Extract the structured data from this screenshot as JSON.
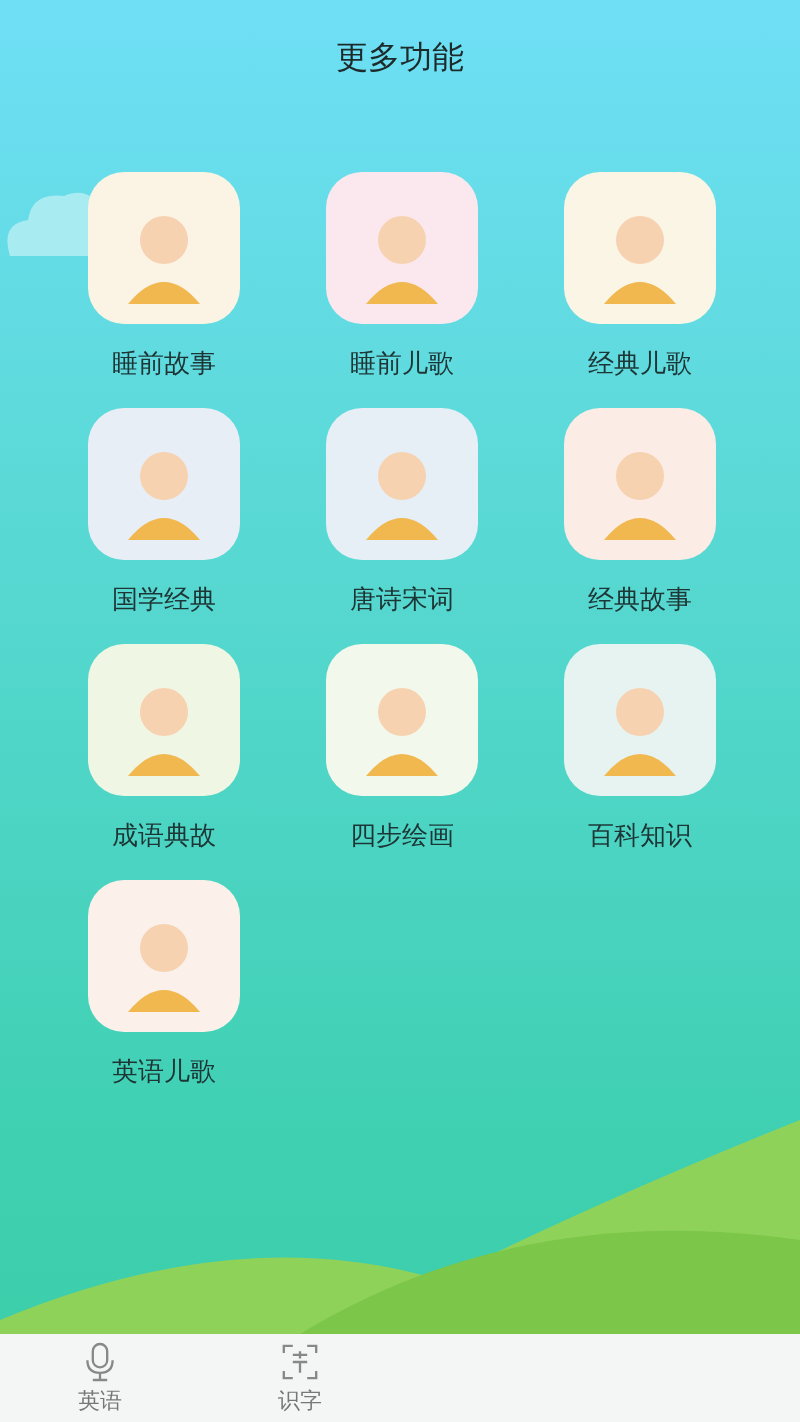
{
  "title": "更多功能",
  "features": [
    {
      "label": "睡前故事"
    },
    {
      "label": "睡前儿歌"
    },
    {
      "label": "经典儿歌"
    },
    {
      "label": "国学经典"
    },
    {
      "label": "唐诗宋词"
    },
    {
      "label": "经典故事"
    },
    {
      "label": "成语典故"
    },
    {
      "label": "四步绘画"
    },
    {
      "label": "百科知识"
    },
    {
      "label": "英语儿歌"
    }
  ],
  "tab_bar": [
    {
      "label": "英语",
      "kind": "microphone"
    },
    {
      "label": "识字",
      "kind": "scan"
    }
  ]
}
